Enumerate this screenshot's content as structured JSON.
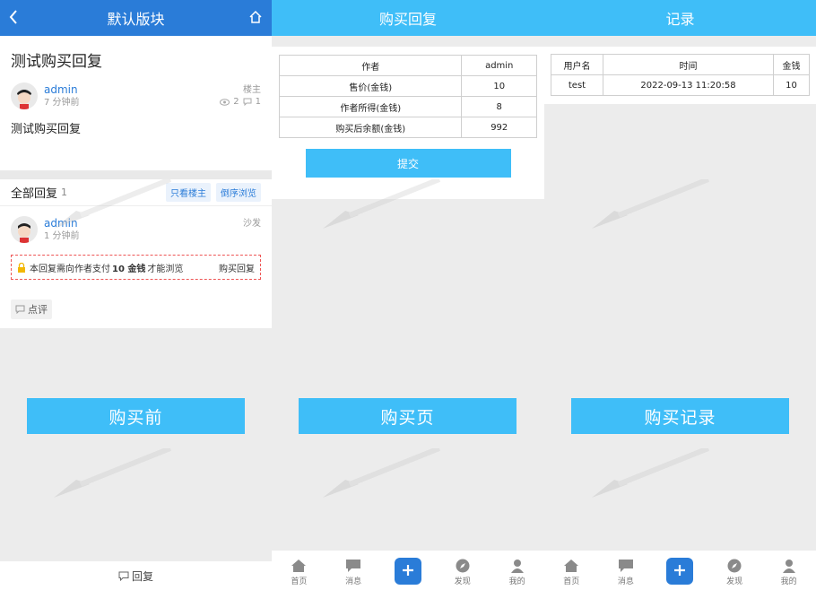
{
  "panel1": {
    "header_title": "默认版块",
    "post": {
      "title": "测试购买回复",
      "author": "admin",
      "time": "7 分钟前",
      "role": "楼主",
      "views": "2",
      "replies": "1",
      "body": "测试购买回复"
    },
    "replies_section": {
      "title": "全部回复",
      "count": "1",
      "only_author_label": "只看楼主",
      "reverse_label": "倒序浏览"
    },
    "reply": {
      "author": "admin",
      "time": "1 分钟前",
      "floor": "沙发",
      "pay_prefix": "本回复需向作者支付",
      "pay_amount": "10 金钱",
      "pay_suffix": "才能浏览",
      "buy_label": "购买回复",
      "comment_label": "点评"
    },
    "bottom_reply_label": "回复",
    "caption": "购买前"
  },
  "panel2": {
    "header_title": "购买回复",
    "table": [
      [
        "作者",
        "admin"
      ],
      [
        "售价(金钱)",
        "10"
      ],
      [
        "作者所得(金钱)",
        "8"
      ],
      [
        "购买后余额(金钱)",
        "992"
      ]
    ],
    "submit_label": "提交",
    "caption": "购买页"
  },
  "panel3": {
    "header_title": "记录",
    "columns": [
      "用户名",
      "时间",
      "金钱"
    ],
    "rows": [
      [
        "test",
        "2022-09-13 11:20:58",
        "10"
      ]
    ],
    "caption": "购买记录"
  },
  "tabbar": {
    "home": "首页",
    "messages": "消息",
    "discover": "发现",
    "mine": "我的"
  },
  "colors": {
    "header_dark": "#2a7cd8",
    "header_light": "#3fbef8",
    "accent": "#3fbef8"
  }
}
